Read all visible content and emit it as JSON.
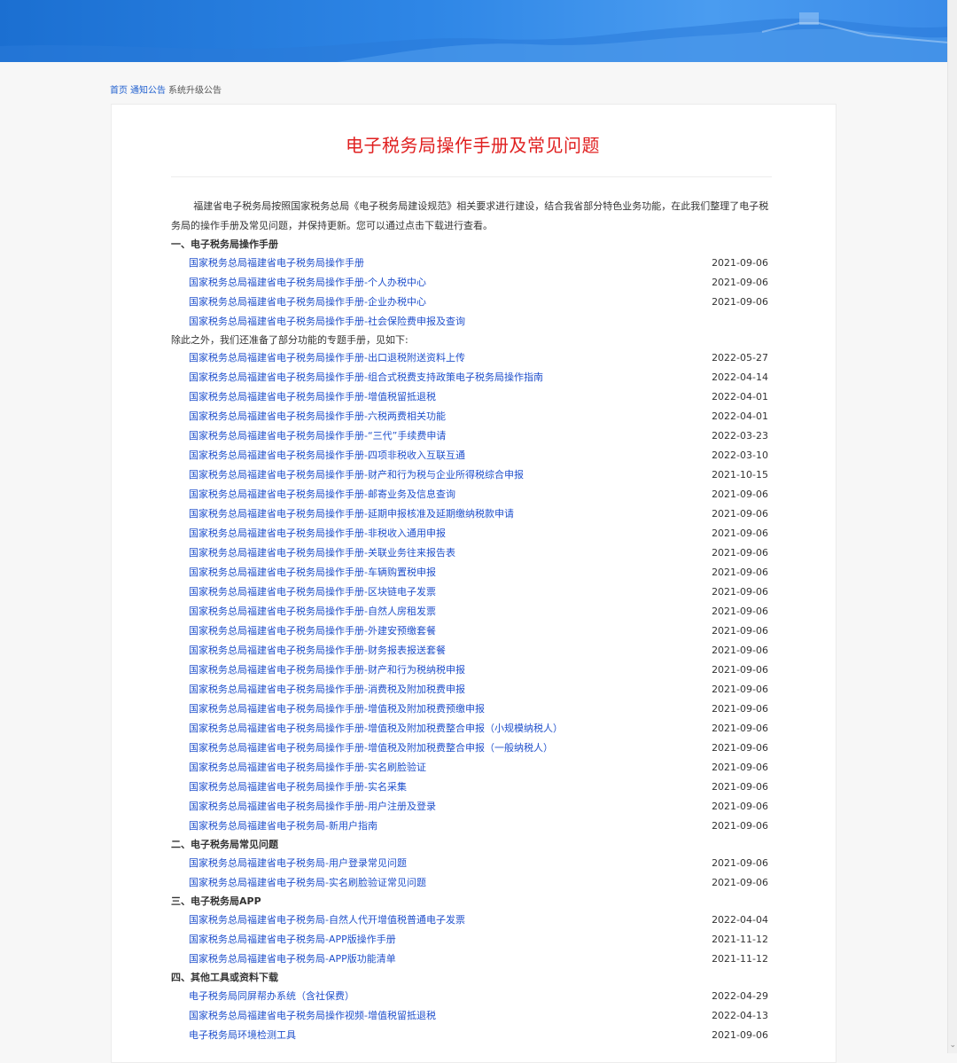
{
  "breadcrumb": [
    "首页",
    "通知公告",
    "系统升级公告"
  ],
  "title": "电子税务局操作手册及常见问题",
  "intro": "福建省电子税务局按照国家税务总局《电子税务局建设规范》相关要求进行建设，结合我省部分特色业务功能，在此我们整理了电子税务局的操作手册及常见问题，并保持更新。您可以通过点击下载进行查看。",
  "sections": {
    "s1": {
      "heading": "一、电子税务局操作手册",
      "items": [
        {
          "text": "国家税务总局福建省电子税务局操作手册",
          "date": "2021-09-06"
        },
        {
          "text": "国家税务总局福建省电子税务局操作手册-个人办税中心",
          "date": "2021-09-06"
        },
        {
          "text": "国家税务总局福建省电子税务局操作手册-企业办税中心",
          "date": "2021-09-06"
        },
        {
          "text": "国家税务总局福建省电子税务局操作手册-社会保险费申报及查询",
          "date": ""
        }
      ],
      "note": "除此之外，我们还准备了部分功能的专题手册，见如下:",
      "special": [
        {
          "text": "国家税务总局福建省电子税务局操作手册-出口退税附送资料上传",
          "date": "2022-05-27"
        },
        {
          "text": "国家税务总局福建省电子税务局操作手册-组合式税费支持政策电子税务局操作指南",
          "date": "2022-04-14"
        },
        {
          "text": "国家税务总局福建省电子税务局操作手册-增值税留抵退税",
          "date": "2022-04-01"
        },
        {
          "text": "国家税务总局福建省电子税务局操作手册-六税两费相关功能",
          "date": "2022-04-01"
        },
        {
          "text": "国家税务总局福建省电子税务局操作手册-“三代”手续费申请",
          "date": "2022-03-23"
        },
        {
          "text": "国家税务总局福建省电子税务局操作手册-四项非税收入互联互通",
          "date": "2022-03-10"
        },
        {
          "text": "国家税务总局福建省电子税务局操作手册-财产和行为税与企业所得税综合申报",
          "date": "2021-10-15"
        },
        {
          "text": "国家税务总局福建省电子税务局操作手册-邮寄业务及信息查询",
          "date": "2021-09-06"
        },
        {
          "text": "国家税务总局福建省电子税务局操作手册-延期申报核准及延期缴纳税款申请",
          "date": "2021-09-06"
        },
        {
          "text": "国家税务总局福建省电子税务局操作手册-非税收入通用申报",
          "date": "2021-09-06"
        },
        {
          "text": "国家税务总局福建省电子税务局操作手册-关联业务往来报告表",
          "date": "2021-09-06"
        },
        {
          "text": "国家税务总局福建省电子税务局操作手册-车辆购置税申报",
          "date": "2021-09-06"
        },
        {
          "text": "国家税务总局福建省电子税务局操作手册-区块链电子发票",
          "date": "2021-09-06"
        },
        {
          "text": "国家税务总局福建省电子税务局操作手册-自然人房租发票",
          "date": "2021-09-06"
        },
        {
          "text": "国家税务总局福建省电子税务局操作手册-外建安预缴套餐",
          "date": "2021-09-06"
        },
        {
          "text": "国家税务总局福建省电子税务局操作手册-财务报表报送套餐",
          "date": "2021-09-06"
        },
        {
          "text": "国家税务总局福建省电子税务局操作手册-财产和行为税纳税申报",
          "date": "2021-09-06"
        },
        {
          "text": "国家税务总局福建省电子税务局操作手册-消费税及附加税费申报",
          "date": "2021-09-06"
        },
        {
          "text": "国家税务总局福建省电子税务局操作手册-增值税及附加税费预缴申报",
          "date": "2021-09-06"
        },
        {
          "text": "国家税务总局福建省电子税务局操作手册-增值税及附加税费整合申报（小规模纳税人）",
          "date": "2021-09-06"
        },
        {
          "text": "国家税务总局福建省电子税务局操作手册-增值税及附加税费整合申报（一般纳税人）",
          "date": "2021-09-06"
        },
        {
          "text": "国家税务总局福建省电子税务局操作手册-实名刷脸验证",
          "date": "2021-09-06"
        },
        {
          "text": "国家税务总局福建省电子税务局操作手册-实名采集",
          "date": "2021-09-06"
        },
        {
          "text": "国家税务总局福建省电子税务局操作手册-用户注册及登录",
          "date": "2021-09-06"
        },
        {
          "text": "国家税务总局福建省电子税务局-新用户指南",
          "date": "2021-09-06"
        }
      ]
    },
    "s2": {
      "heading": "二、电子税务局常见问题",
      "items": [
        {
          "text": "国家税务总局福建省电子税务局-用户登录常见问题",
          "date": "2021-09-06"
        },
        {
          "text": "国家税务总局福建省电子税务局-实名刷脸验证常见问题",
          "date": "2021-09-06"
        }
      ]
    },
    "s3": {
      "heading": "三、电子税务局APP",
      "items": [
        {
          "text": "国家税务总局福建省电子税务局-自然人代开增值税普通电子发票",
          "date": "2022-04-04"
        },
        {
          "text": "国家税务总局福建省电子税务局-APP版操作手册",
          "date": "2021-11-12"
        },
        {
          "text": "国家税务总局福建省电子税务局-APP版功能清单",
          "date": "2021-11-12"
        }
      ]
    },
    "s4": {
      "heading": "四、其他工具或资料下载",
      "items": [
        {
          "text": "电子税务局同屏帮办系统（含社保费）",
          "date": "2022-04-29"
        },
        {
          "text": "国家税务总局福建省电子税务局操作视频-增值税留抵退税",
          "date": "2022-04-13"
        },
        {
          "text": "电子税务局环境检测工具",
          "date": "2021-09-06"
        }
      ]
    }
  },
  "colors": {
    "link": "#2050cc",
    "title": "#e02020",
    "banner": "#2e86e6"
  },
  "icons": {
    "scroll_down": "chevron-down-icon"
  }
}
